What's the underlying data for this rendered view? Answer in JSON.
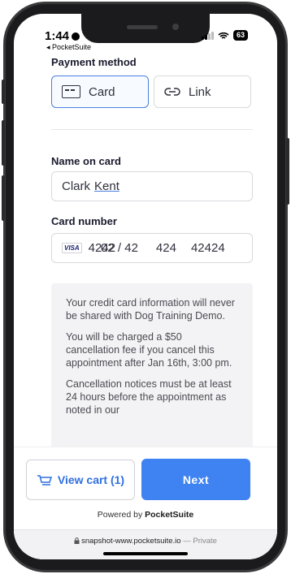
{
  "status_bar": {
    "time": "1:44",
    "back_app": "◂ PocketSuite",
    "battery": "63"
  },
  "payment": {
    "title": "Payment method",
    "methods": [
      {
        "label": "Card",
        "icon": "card-icon",
        "selected": true
      },
      {
        "label": "Link",
        "icon": "link-icon",
        "selected": false
      }
    ]
  },
  "name_on_card": {
    "label": "Name on card",
    "value_first": "Clark",
    "value_last": "Kent"
  },
  "card_number": {
    "label": "Card number",
    "brand": "VISA",
    "number_display": "4242",
    "expiry_display": "02 / 42",
    "cvc_display": "424",
    "zip_display": "42424"
  },
  "notice": {
    "paragraphs": [
      "Your credit card information will never be shared with Dog Training Demo.",
      "You will be charged a $50 cancellation fee if you cancel this appointment after Jan 16th, 3:00 pm.",
      "Cancellation notices must be at least 24 hours before the appointment as noted in our"
    ]
  },
  "footer": {
    "view_cart_label": "View cart (1)",
    "next_label": "Next",
    "powered_prefix": "Powered by ",
    "powered_brand": "PocketSuite"
  },
  "browser": {
    "url": "snapshot-www.pocketsuite.io",
    "private_label": " — Private"
  },
  "colors": {
    "accent": "#3f82f1",
    "selected_border": "#4a7fe0"
  }
}
